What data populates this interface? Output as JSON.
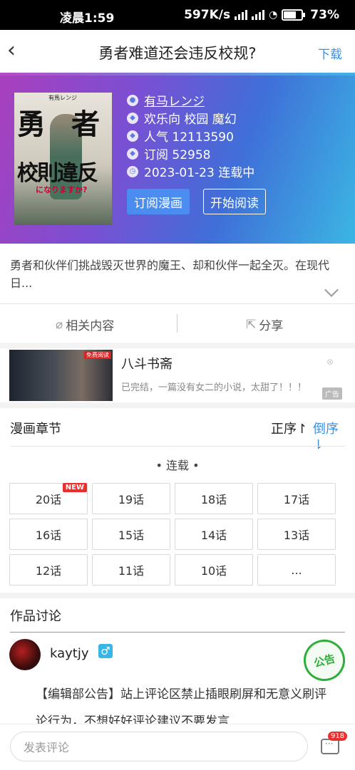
{
  "status": {
    "time": "凌晨1:59",
    "speed": "597K/s",
    "battery": "73%"
  },
  "nav": {
    "title": "勇者难道还会违反校规?",
    "download": "下载"
  },
  "comic": {
    "author": "有马レンジ",
    "tags": "欢乐向 校园 魔幻",
    "popularity": "人气 12113590",
    "subscriptions": "订阅 52958",
    "update": "2023-01-23 连载中",
    "cover": {
      "author": "有馬レンジ",
      "title_a": "勇",
      "title_b": "者",
      "title_c": "校則違反",
      "subtitle": "になりますか?"
    }
  },
  "buttons": {
    "subscribe": "订阅漫画",
    "read": "开始阅读"
  },
  "description": "勇者和伙伴们挑战毁灭世界的魔王、却和伙伴一起全灭。在现代日...",
  "actions": {
    "related": "相关内容",
    "share": "分享"
  },
  "ad": {
    "name": "八斗书斋",
    "text": "已完结，一篇没有女二的小说，太甜了！！！",
    "label": "广告",
    "tag": "免费阅读"
  },
  "chapters": {
    "title": "漫画章节",
    "order_asc": "正序↾",
    "order_desc": "倒序⇂",
    "section": "• 连载 •",
    "new_badge": "NEW",
    "items": [
      "20话",
      "19话",
      "18话",
      "17话",
      "16话",
      "15话",
      "14话",
      "13话",
      "12话",
      "11话",
      "10话",
      "..."
    ]
  },
  "discussion": {
    "title": "作品讨论",
    "username": "kaytjy",
    "gender": "♂",
    "stamp": "公告",
    "text": "【编辑部公告】站上评论区禁止插眼刷屏和无意义刷评论行为，不想好好评论建议不要发言"
  },
  "comment": {
    "placeholder": "发表评论",
    "count": "918"
  },
  "colors": {
    "accent": "#3d8fe0",
    "hero_start": "#a93fbd",
    "hero_end": "#3bb6e3",
    "badge": "#e8312f"
  }
}
